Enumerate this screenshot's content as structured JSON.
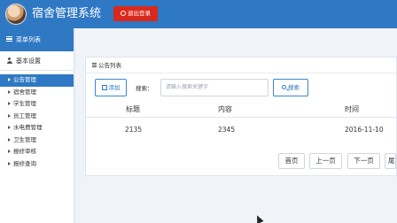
{
  "header": {
    "app_title": "宿舍管理系统",
    "logout_label": "退出登录",
    "brand_color": "#2f78c4",
    "logout_color": "#d9291c"
  },
  "sidebar": {
    "menu_title": "菜单列表",
    "group_title": "基本设置",
    "items": [
      {
        "label": "公告管理",
        "active": true
      },
      {
        "label": "宿舍管理",
        "active": false
      },
      {
        "label": "学生管理",
        "active": false
      },
      {
        "label": "员工管理",
        "active": false
      },
      {
        "label": "水电费管理",
        "active": false
      },
      {
        "label": "卫生管理",
        "active": false
      },
      {
        "label": "报修审核",
        "active": false
      },
      {
        "label": "报修查询",
        "active": false
      }
    ]
  },
  "main": {
    "panel_title": "公告列表",
    "add_label": "添加",
    "search_label": "搜索：",
    "search_placeholder": "请输入搜索关键字",
    "search_button": "搜索",
    "table": {
      "columns": [
        "标题",
        "内容",
        "时间"
      ],
      "rows": [
        [
          "2135",
          "2345",
          "2016-11-10"
        ]
      ]
    },
    "pager": {
      "first": "首页",
      "prev": "上一页",
      "next": "下一页",
      "last": "尾"
    }
  }
}
